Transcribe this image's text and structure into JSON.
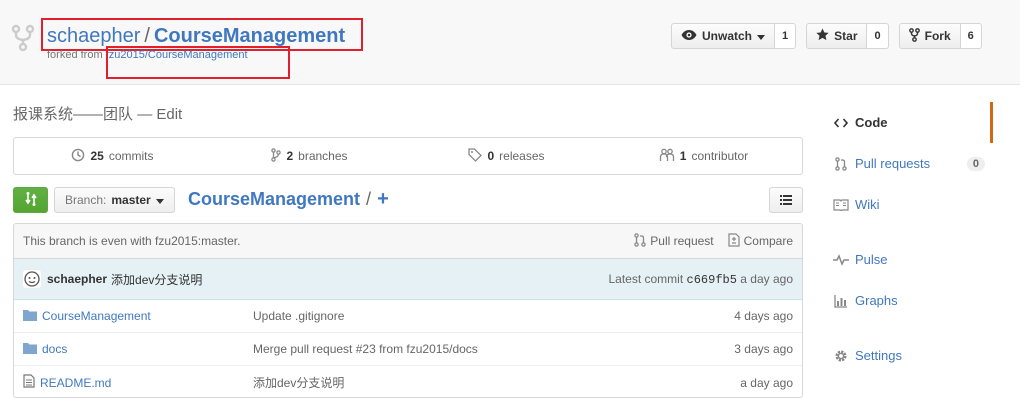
{
  "repo": {
    "owner": "schaepher",
    "separator": "/",
    "name": "CourseManagement",
    "forked_label": "forked from",
    "forked_from": "fzu2015/CourseManagement"
  },
  "actions": {
    "watch_label": "Unwatch",
    "watch_count": "1",
    "star_label": "Star",
    "star_count": "0",
    "fork_label": "Fork",
    "fork_count": "6"
  },
  "description": {
    "text": "报课系统——团队",
    "dash": "—",
    "edit_label": "Edit"
  },
  "summary": {
    "commits_num": "25",
    "commits_label": "commits",
    "branches_num": "2",
    "branches_label": "branches",
    "releases_num": "0",
    "releases_label": "releases",
    "contributors_num": "1",
    "contributors_label": "contributor"
  },
  "file_nav": {
    "branch_label": "Branch:",
    "branch_value": "master",
    "breadcrumb_root": "CourseManagement",
    "breadcrumb_sep": "/",
    "add_file": "+"
  },
  "branch_info": {
    "text": "This branch is even with fzu2015:master.",
    "pull_request": "Pull request",
    "compare": "Compare"
  },
  "latest_commit": {
    "author": "schaepher",
    "message": "添加dev分支说明",
    "label": "Latest commit",
    "sha": "c669fb5",
    "age": "a day ago"
  },
  "files": [
    {
      "type": "folder",
      "name": "CourseManagement",
      "message": "Update .gitignore",
      "age": "4 days ago"
    },
    {
      "type": "folder",
      "name": "docs",
      "message": "Merge pull request #23 from fzu2015/docs",
      "age": "3 days ago"
    },
    {
      "type": "file",
      "name": "README.md",
      "message": "添加dev分支说明",
      "age": "a day ago"
    }
  ],
  "nav": {
    "code": "Code",
    "pull_requests": "Pull requests",
    "pull_requests_count": "0",
    "wiki": "Wiki",
    "pulse": "Pulse",
    "graphs": "Graphs",
    "settings": "Settings"
  },
  "colors": {
    "link": "#4078c0",
    "highlight_box": "#e0202a",
    "selected_nav": "#d26911",
    "compare_green": "#55a532"
  }
}
